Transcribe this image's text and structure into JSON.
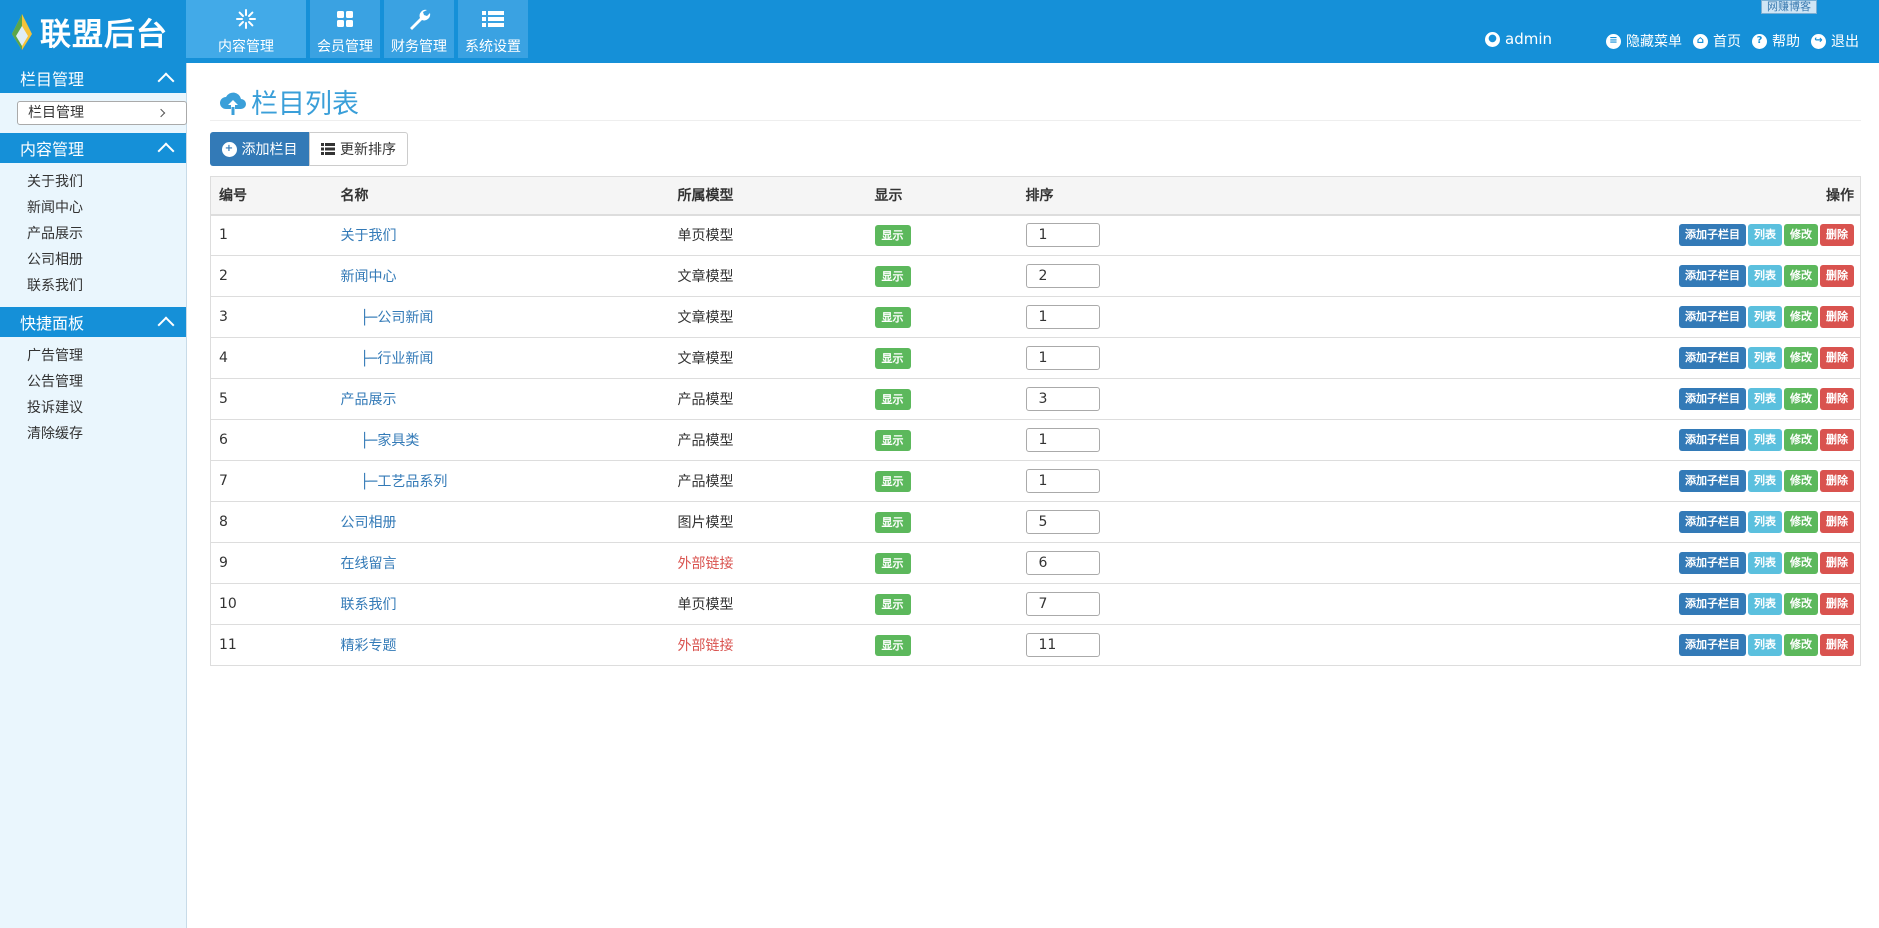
{
  "header": {
    "logo": "联盟后台",
    "tabs": [
      {
        "label": "内容管理",
        "icon": "snowflake-icon"
      },
      {
        "label": "会员管理",
        "icon": "grid-icon"
      },
      {
        "label": "财务管理",
        "icon": "wrench-icon"
      },
      {
        "label": "系统设置",
        "icon": "list-icon"
      }
    ],
    "user": "admin",
    "links": [
      "隐藏菜单",
      "首页",
      "帮助",
      "退出"
    ],
    "floating_tag": "网赚博客"
  },
  "sidebar": {
    "groups": [
      {
        "title": "栏目管理",
        "items": [
          "栏目管理"
        ]
      },
      {
        "title": "内容管理",
        "items": [
          "关于我们",
          "新闻中心",
          "产品展示",
          "公司相册",
          "联系我们"
        ]
      },
      {
        "title": "快捷面板",
        "items": [
          "广告管理",
          "公告管理",
          "投诉建议",
          "清除缓存"
        ]
      }
    ]
  },
  "main": {
    "title": "栏目列表",
    "add_button": "添加栏目",
    "sort_button": "更新排序",
    "columns": [
      "编号",
      "名称",
      "所属模型",
      "显示",
      "排序",
      "操作"
    ],
    "row_actions": [
      "添加子栏目",
      "列表",
      "修改",
      "删除"
    ],
    "rows": [
      {
        "id": "1",
        "name": "关于我们",
        "model": "单页模型",
        "show": "显示",
        "sort": "1"
      },
      {
        "id": "2",
        "name": "新闻中心",
        "model": "文章模型",
        "show": "显示",
        "sort": "2"
      },
      {
        "id": "3",
        "name": "├─公司新闻",
        "model": "文章模型",
        "show": "显示",
        "sort": "1"
      },
      {
        "id": "4",
        "name": "├─行业新闻",
        "model": "文章模型",
        "show": "显示",
        "sort": "1"
      },
      {
        "id": "5",
        "name": "产品展示",
        "model": "产品模型",
        "show": "显示",
        "sort": "3"
      },
      {
        "id": "6",
        "name": "├─家具类",
        "model": "产品模型",
        "show": "显示",
        "sort": "1"
      },
      {
        "id": "7",
        "name": "├─工艺品系列",
        "model": "产品模型",
        "show": "显示",
        "sort": "1"
      },
      {
        "id": "8",
        "name": "公司相册",
        "model": "图片模型",
        "show": "显示",
        "sort": "5"
      },
      {
        "id": "9",
        "name": "在线留言",
        "model": "外部链接",
        "show": "显示",
        "sort": "6"
      },
      {
        "id": "10",
        "name": "联系我们",
        "model": "单页模型",
        "show": "显示",
        "sort": "7"
      },
      {
        "id": "11",
        "name": "精彩专题",
        "model": "外部链接",
        "show": "显示",
        "sort": "11"
      }
    ]
  }
}
